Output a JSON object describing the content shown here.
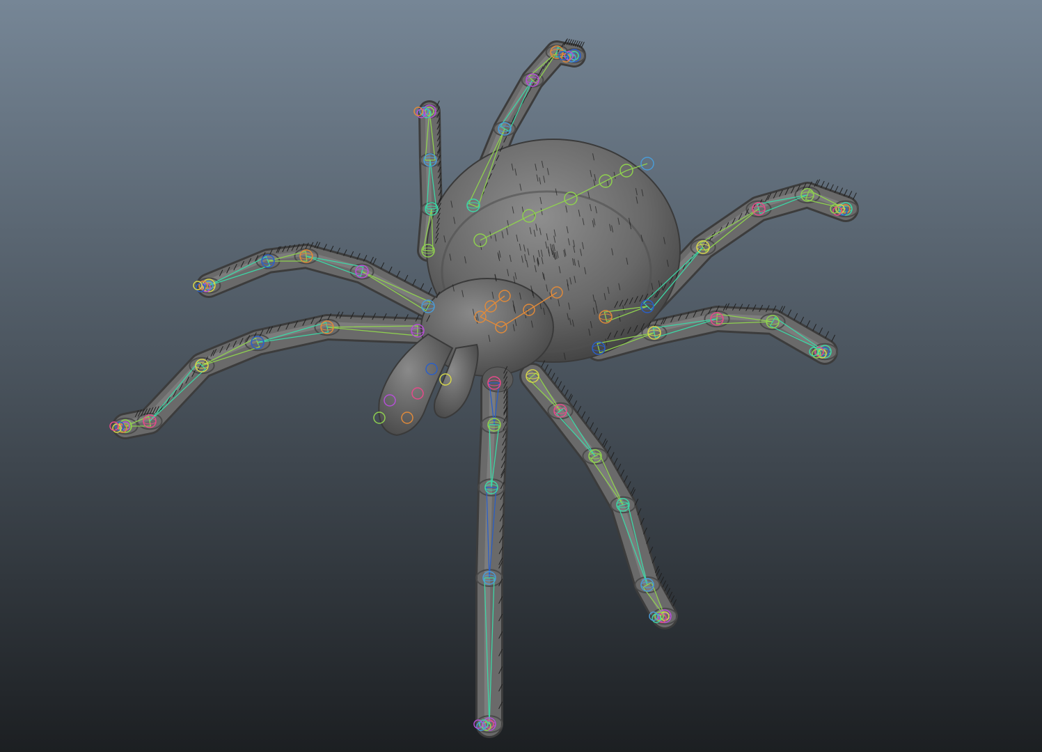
{
  "viewport": {
    "background_top": "#768696",
    "background_bottom": "#1c1f22",
    "mesh_color": "#6a6a6a",
    "mesh_shadow": "#3c3c3c",
    "mesh_highlight": "#8e8e8e",
    "hair_color": "#1f1f1f"
  },
  "rig": {
    "joint_colors": [
      "#8fd14f",
      "#3dd6a5",
      "#4a9bd6",
      "#b64fd6",
      "#e08a3a",
      "#2a5fc8",
      "#d6d64a",
      "#e64a8a"
    ],
    "bone_colors": {
      "leg": "#8fd14f",
      "spine": "#e08a3a",
      "back_leg": "#2a5fc8",
      "tip": "#3dd6a5"
    },
    "control_icons": [
      "joint-circle-icon",
      "ik-handle-icon",
      "end-effector-icon"
    ]
  }
}
